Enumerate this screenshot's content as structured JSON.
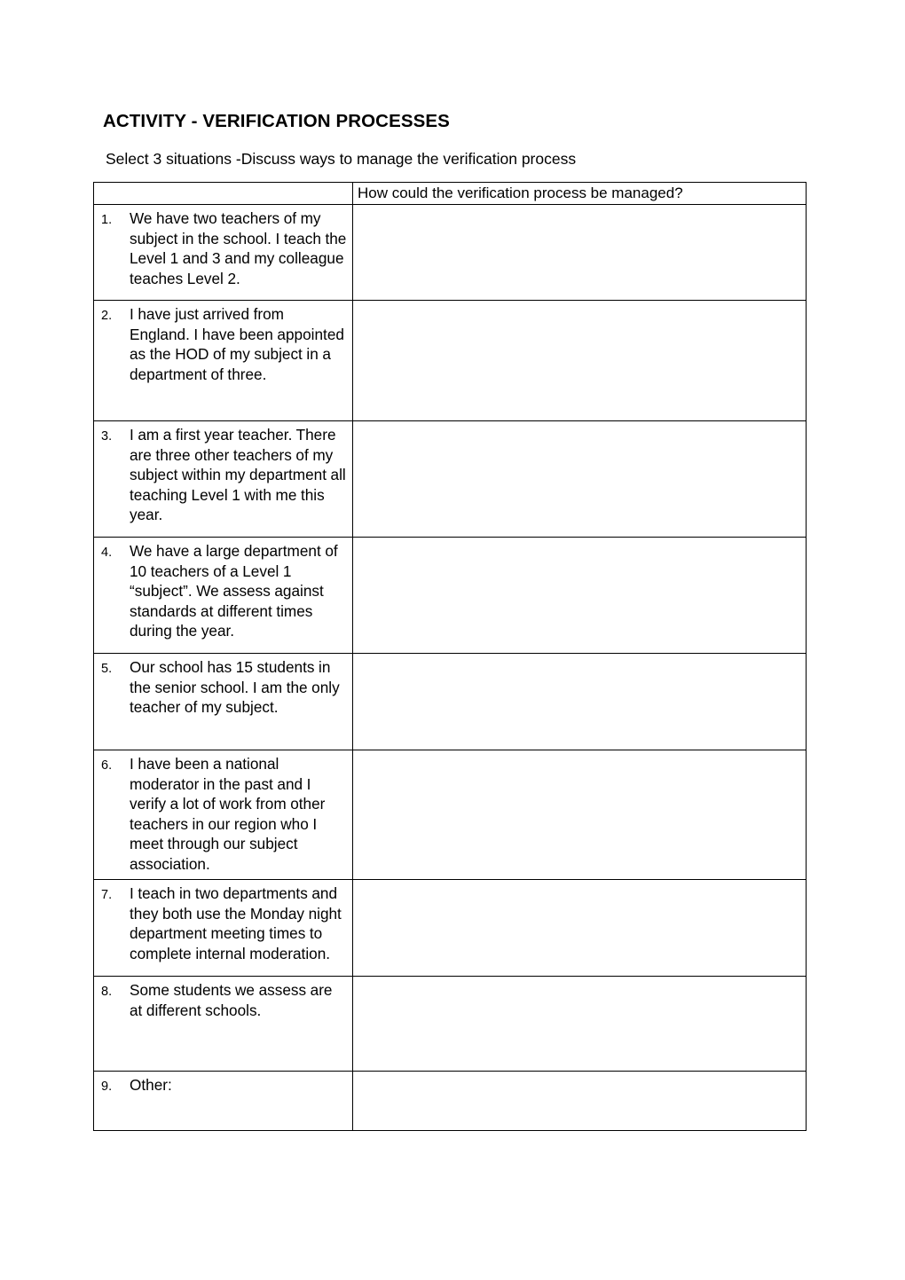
{
  "document": {
    "title": "ACTIVITY - VERIFICATION PROCESSES",
    "subtitle": "Select 3 situations -Discuss ways to manage the verification process"
  },
  "table": {
    "header": {
      "left_label": "",
      "right_label": "How could the verification process be managed?"
    },
    "rows": [
      {
        "number": "1.",
        "situation": "We have two teachers of my subject in the school. I teach the Level 1 and 3 and my colleague teaches Level 2.",
        "answer": ""
      },
      {
        "number": "2.",
        "situation": "I have just arrived from England. I have been appointed as the HOD of my subject in a department of three.",
        "answer": ""
      },
      {
        "number": "3.",
        "situation": "I am a first year teacher. There are three other teachers of my subject within my department all teaching Level 1 with me this year.",
        "answer": ""
      },
      {
        "number": "4.",
        "situation": "We have a large department of 10 teachers of a Level 1 “subject”. We assess against standards at different times during the year.",
        "answer": ""
      },
      {
        "number": "5.",
        "situation": "Our school has 15 students in the senior school. I am the only teacher of my subject.",
        "answer": ""
      },
      {
        "number": "6.",
        "situation": "I have been a national moderator in the past and I verify a lot of work from other teachers in our region who I meet through our subject association.",
        "answer": ""
      },
      {
        "number": "7.",
        "situation": "I teach in two departments and they both use the Monday night department meeting times to complete internal moderation.",
        "answer": ""
      },
      {
        "number": "8.",
        "situation": "Some students we assess are at different schools.",
        "answer": ""
      },
      {
        "number": "9.",
        "situation": "Other:",
        "answer": ""
      }
    ]
  }
}
